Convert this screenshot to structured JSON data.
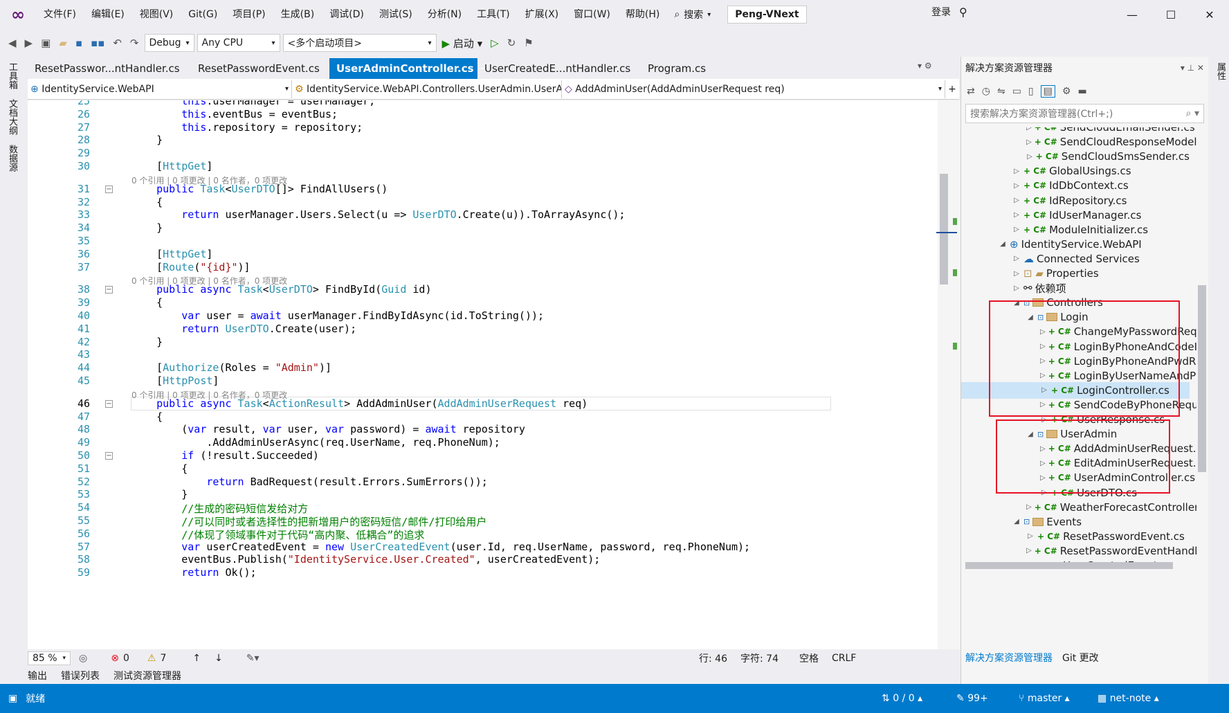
{
  "menu": {
    "items": [
      "文件(F)",
      "编辑(E)",
      "视图(V)",
      "Git(G)",
      "项目(P)",
      "生成(B)",
      "调试(D)",
      "测试(S)",
      "分析(N)",
      "工具(T)",
      "扩展(X)",
      "窗口(W)",
      "帮助(H)"
    ],
    "search": "搜索",
    "solution": "Peng-VNext",
    "login": "登录"
  },
  "toolbar": {
    "config": "Debug",
    "platform": "Any CPU",
    "startup": "<多个启动项目>",
    "start": "启动"
  },
  "left_tabs": [
    "工具箱",
    "文档大纲",
    "数据源"
  ],
  "right_tab": "属性",
  "tabs": [
    "ResetPasswor...ntHandler.cs",
    "ResetPasswordEvent.cs",
    "UserAdminController.cs",
    "UserCreatedE...ntHandler.cs",
    "Program.cs"
  ],
  "nav": {
    "project": "IdentityService.WebAPI",
    "class": "IdentityService.WebAPI.Controllers.UserAdmin.UserA",
    "member": "AddAdminUser(AddAdminUserRequest req)"
  },
  "lens": "0 个引用 | 0 项更改 | 0 名作者，0 项更改",
  "editor_status": {
    "zoom": "85 %",
    "errors": "0",
    "warnings": "7",
    "line": "行: 46",
    "col": "字符: 74",
    "ws": "空格",
    "eol": "CRLF"
  },
  "bottom_tabs": [
    "输出",
    "错误列表",
    "测试资源管理器"
  ],
  "se": {
    "title": "解决方案资源管理器",
    "search": "搜索解决方案资源管理器(Ctrl+;)",
    "items": [
      {
        "label": "SendCloudEmailSender.cs",
        "depth": 3,
        "cs": true
      },
      {
        "label": "SendCloudResponseModel",
        "depth": 3,
        "cs": true
      },
      {
        "label": "SendCloudSmsSender.cs",
        "depth": 3,
        "cs": true
      },
      {
        "label": "GlobalUsings.cs",
        "depth": 2,
        "cs": true
      },
      {
        "label": "IdDbContext.cs",
        "depth": 2,
        "cs": true
      },
      {
        "label": "IdRepository.cs",
        "depth": 2,
        "cs": true
      },
      {
        "label": "IdUserManager.cs",
        "depth": 2,
        "cs": true
      },
      {
        "label": "ModuleInitializer.cs",
        "depth": 2,
        "cs": true
      },
      {
        "label": "IdentityService.WebAPI",
        "depth": 1,
        "open": true
      },
      {
        "label": "Connected Services",
        "depth": 2
      },
      {
        "label": "Properties",
        "depth": 2
      },
      {
        "label": "依赖项",
        "depth": 2
      },
      {
        "label": "Controllers",
        "depth": 2,
        "open": true,
        "folder": true
      },
      {
        "label": "Login",
        "depth": 3,
        "open": true,
        "folder": true
      },
      {
        "label": "ChangeMyPasswordReq",
        "depth": 4,
        "cs": true
      },
      {
        "label": "LoginByPhoneAndCodeI",
        "depth": 4,
        "cs": true
      },
      {
        "label": "LoginByPhoneAndPwdR",
        "depth": 4,
        "cs": true
      },
      {
        "label": "LoginByUserNameAndP",
        "depth": 4,
        "cs": true
      },
      {
        "label": "LoginController.cs",
        "depth": 4,
        "cs": true,
        "selected": true
      },
      {
        "label": "SendCodeByPhoneRequ",
        "depth": 4,
        "cs": true
      },
      {
        "label": "UserResponse.cs",
        "depth": 4,
        "cs": true
      },
      {
        "label": "UserAdmin",
        "depth": 3,
        "open": true,
        "folder": true
      },
      {
        "label": "AddAdminUserRequest.",
        "depth": 4,
        "cs": true
      },
      {
        "label": "EditAdminUserRequest.",
        "depth": 4,
        "cs": true
      },
      {
        "label": "UserAdminController.cs",
        "depth": 4,
        "cs": true
      },
      {
        "label": "UserDTO.cs",
        "depth": 4,
        "cs": true
      },
      {
        "label": "WeatherForecastController",
        "depth": 3,
        "cs": true
      },
      {
        "label": "Events",
        "depth": 2,
        "open": true,
        "folder": true
      },
      {
        "label": "ResetPasswordEvent.cs",
        "depth": 3,
        "cs": true
      },
      {
        "label": "ResetPasswordEventHandle",
        "depth": 3,
        "cs": true
      },
      {
        "label": "UserCreatedEvent.cs",
        "depth": 3,
        "cs": true
      }
    ],
    "bottom_tabs": [
      "解决方案资源管理器",
      "Git 更改"
    ]
  },
  "status": {
    "ready": "就绪",
    "sync": "0 / 0",
    "changes": "99+",
    "branch": "master",
    "repo": "net-note"
  },
  "code": {
    "lines": [
      {
        "n": "25",
        "t": "        this.userManager = userManager;"
      },
      {
        "n": "26",
        "t": "        this.eventBus = eventBus;"
      },
      {
        "n": "27",
        "t": "        this.repository = repository;"
      },
      {
        "n": "28",
        "t": "    }"
      },
      {
        "n": "29",
        "t": ""
      },
      {
        "n": "30",
        "t": "    [HttpGet]"
      },
      {
        "n": "31",
        "t": "    public Task<UserDTO[]> FindAllUsers()"
      },
      {
        "n": "32",
        "t": "    {"
      },
      {
        "n": "33",
        "t": "        return userManager.Users.Select(u => UserDTO.Create(u)).ToArrayAsync();"
      },
      {
        "n": "34",
        "t": "    }"
      },
      {
        "n": "35",
        "t": ""
      },
      {
        "n": "36",
        "t": "    [HttpGet]"
      },
      {
        "n": "37",
        "t": "    [Route(\"{id}\")]"
      },
      {
        "n": "38",
        "t": "    public async Task<UserDTO> FindById(Guid id)"
      },
      {
        "n": "39",
        "t": "    {"
      },
      {
        "n": "40",
        "t": "        var user = await userManager.FindByIdAsync(id.ToString());"
      },
      {
        "n": "41",
        "t": "        return UserDTO.Create(user);"
      },
      {
        "n": "42",
        "t": "    }"
      },
      {
        "n": "43",
        "t": ""
      },
      {
        "n": "44",
        "t": "    [Authorize(Roles = \"Admin\")]"
      },
      {
        "n": "45",
        "t": "    [HttpPost]"
      },
      {
        "n": "46",
        "t": "    public async Task<ActionResult> AddAdminUser(AddAdminUserRequest req)"
      },
      {
        "n": "47",
        "t": "    {"
      },
      {
        "n": "48",
        "t": "        (var result, var user, var password) = await repository"
      },
      {
        "n": "49",
        "t": "            .AddAdminUserAsync(req.UserName, req.PhoneNum);"
      },
      {
        "n": "50",
        "t": "        if (!result.Succeeded)"
      },
      {
        "n": "51",
        "t": "        {"
      },
      {
        "n": "52",
        "t": "            return BadRequest(result.Errors.SumErrors());"
      },
      {
        "n": "53",
        "t": "        }"
      },
      {
        "n": "54",
        "t": "        //生成的密码短信发给对方"
      },
      {
        "n": "55",
        "t": "        //可以同时或者选择性的把新增用户的密码短信/邮件/打印给用户"
      },
      {
        "n": "56",
        "t": "        //体现了领域事件对于代码“高内聚、低耦合”的追求"
      },
      {
        "n": "57",
        "t": "        var userCreatedEvent = new UserCreatedEvent(user.Id, req.UserName, password, req.PhoneNum);"
      },
      {
        "n": "58",
        "t": "        eventBus.Publish(\"IdentityService.User.Created\", userCreatedEvent);"
      },
      {
        "n": "59",
        "t": "        return Ok();"
      }
    ]
  }
}
